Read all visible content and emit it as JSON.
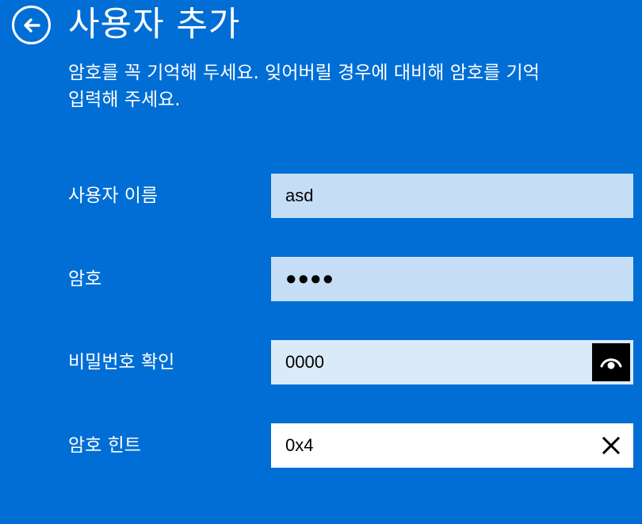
{
  "header": {
    "back_icon": "back-arrow-circle-icon",
    "title": "사용자 추가"
  },
  "description": {
    "line1": "암호를 꼭 기억해 두세요. 잊어버릴 경우에 대비해 암호를 기억",
    "line2": "입력해 주세요."
  },
  "form": {
    "username": {
      "label": "사용자 이름",
      "value": "asd"
    },
    "password": {
      "label": "암호",
      "value": "●●●●"
    },
    "confirm": {
      "label": "비밀번호 확인",
      "value": "0000",
      "reveal_icon": "eye-icon"
    },
    "hint": {
      "label": "암호 힌트",
      "value": "0x4",
      "clear_icon": "close-icon"
    }
  },
  "colors": {
    "background": "#006ed4",
    "field_focused": "#c6def5",
    "field_light": "#dbeaf8",
    "field_white": "#ffffff",
    "text_light": "#ffffff",
    "text_dark": "#000000"
  }
}
